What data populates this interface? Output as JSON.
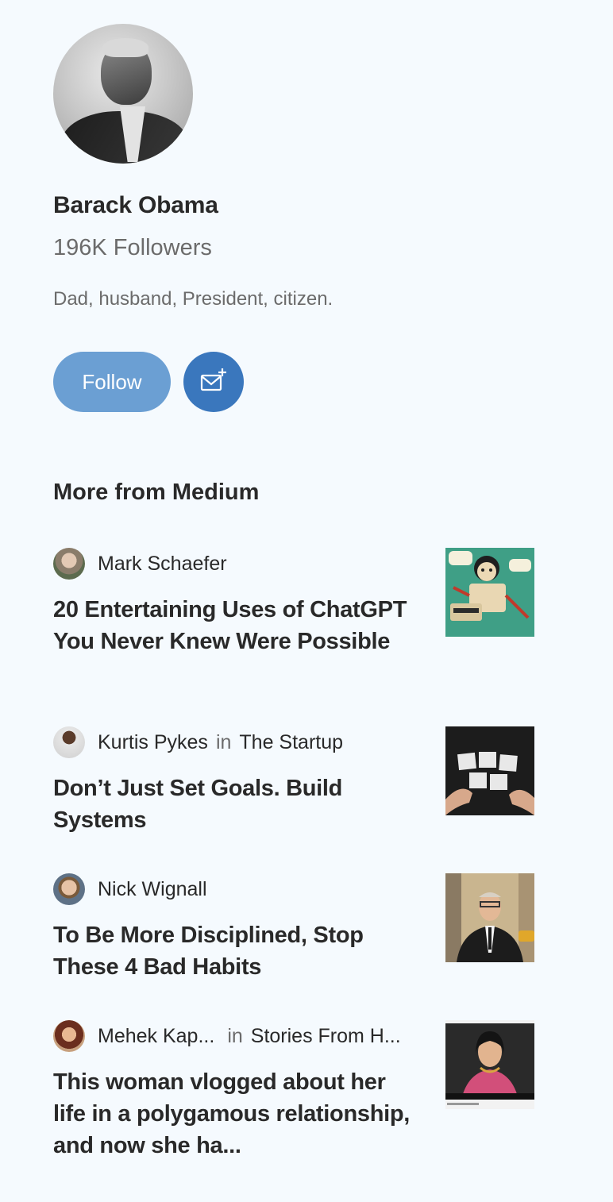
{
  "profile": {
    "name": "Barack Obama",
    "followers": "196K Followers",
    "bio": "Dad, husband, President, citizen.",
    "follow_label": "Follow",
    "subscribe_icon": "mail-plus-icon"
  },
  "colors": {
    "background": "#f5fafe",
    "follow_button": "#6b9fd3",
    "subscribe_button": "#3a77bd",
    "text_primary": "#292929",
    "text_secondary": "#6b6b6b"
  },
  "more_from": {
    "heading": "More from Medium",
    "stories": [
      {
        "author": "Mark Schaefer",
        "in": "",
        "publication": "",
        "title": "20 Entertaining Uses of ChatGPT You Never Knew Were Possible"
      },
      {
        "author": "Kurtis Pykes",
        "in": "in",
        "publication": "The Startup",
        "title": "Don’t Just Set Goals. Build Systems"
      },
      {
        "author": "Nick Wignall",
        "in": "",
        "publication": "",
        "title": "To Be More Disciplined, Stop These 4 Bad Habits"
      },
      {
        "author": "Mehek Kap...",
        "in": "in",
        "publication": "Stories From H...",
        "title": "This woman vlogged about her life in a polygamous relationship, and now she ha..."
      }
    ]
  }
}
